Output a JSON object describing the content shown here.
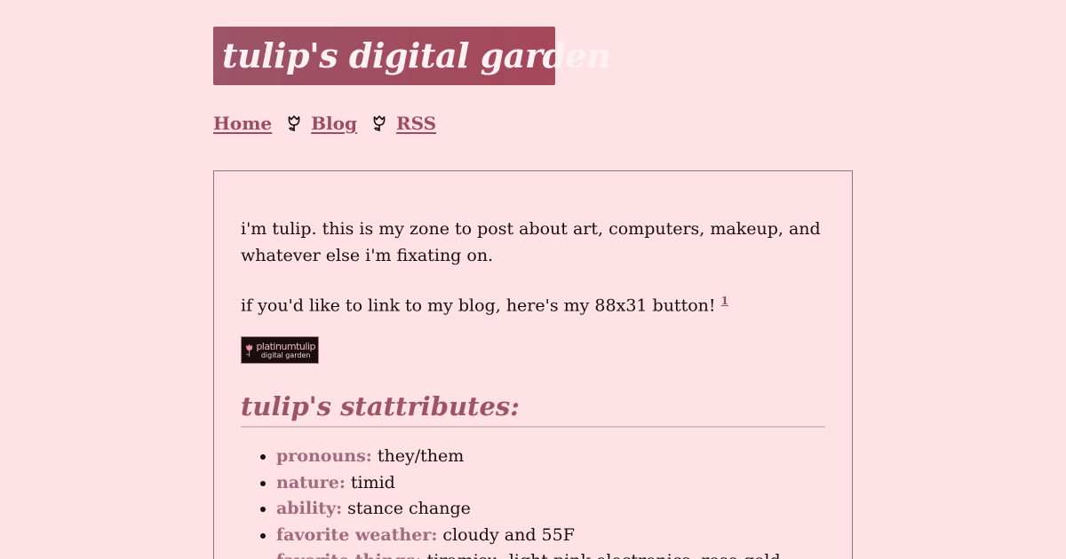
{
  "header": {
    "title": "tulip's digital garden"
  },
  "nav": {
    "items": [
      {
        "label": "Home"
      },
      {
        "label": "Blog"
      },
      {
        "label": "RSS"
      }
    ],
    "separator_icon": "tulip-icon"
  },
  "main": {
    "intro": "i'm tulip. this is my zone to post about art, computers, makeup, and whatever else i'm fixating on.",
    "link_text": "if you'd like to link to my blog, here's my 88x31 button!",
    "footnote_ref": "1",
    "button": {
      "line1": "platinumtulip",
      "line2": "digital garden"
    },
    "stats_heading": "tulip's stattributes:",
    "stats": [
      {
        "key": "pronouns:",
        "value": "they/them"
      },
      {
        "key": "nature:",
        "value": "timid"
      },
      {
        "key": "ability:",
        "value": "stance change"
      },
      {
        "key": "favorite weather:",
        "value": "cloudy and 55F"
      },
      {
        "key": "favorite things:",
        "value": "tiramisu, light pink electronics, rose gold"
      }
    ]
  },
  "colors": {
    "background": "#ffe2e5",
    "accent": "#9c4d63",
    "title_bg": "#a6475a"
  }
}
